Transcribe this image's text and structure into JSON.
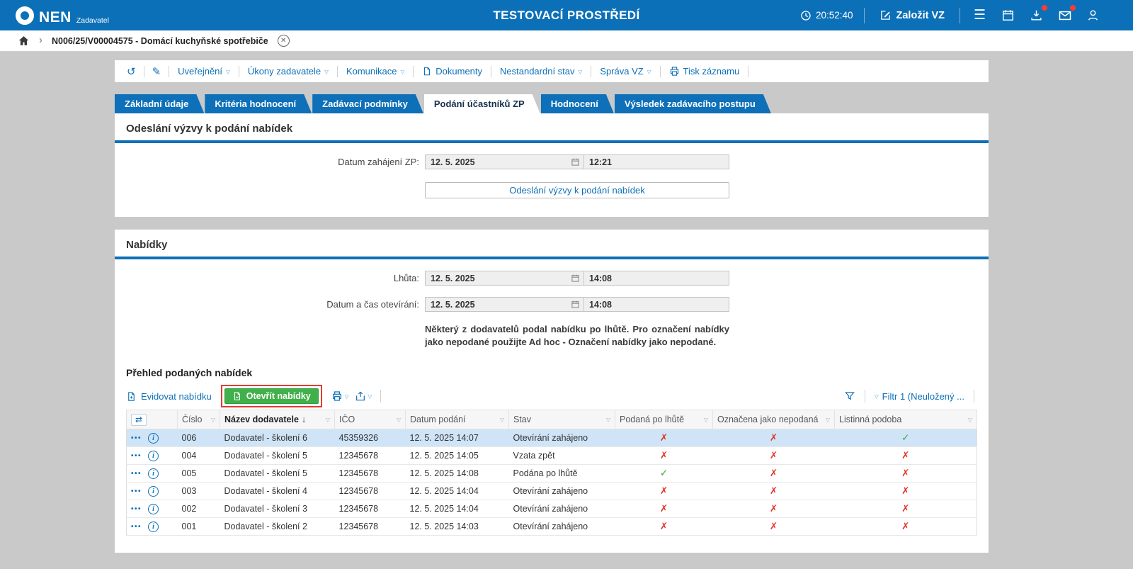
{
  "topbar": {
    "brand": "NEN",
    "brand_sub": "Zadavatel",
    "env_title": "TESTOVACÍ PROSTŘEDÍ",
    "clock": "20:52:40",
    "create_button": "Založit VZ"
  },
  "breadcrumb": {
    "record": "N006/25/V00004575 - Domácí kuchyňské spotřebiče"
  },
  "record_toolbar": {
    "uverejneni": "Uveřejnění",
    "ukony": "Úkony zadavatele",
    "komunikace": "Komunikace",
    "dokumenty": "Dokumenty",
    "nestandardni": "Nestandardní stav",
    "sprava": "Správa VZ",
    "tisk": "Tisk záznamu"
  },
  "tabs": [
    {
      "label": "Základní údaje",
      "active": "false"
    },
    {
      "label": "Kritéria hodnocení",
      "active": "false"
    },
    {
      "label": "Zadávací podmínky",
      "active": "false"
    },
    {
      "label": "Podání účastníků ZP",
      "active": "true"
    },
    {
      "label": "Hodnocení",
      "active": "false"
    },
    {
      "label": "Výsledek zadávacího postupu",
      "active": "false"
    }
  ],
  "invitation_section": {
    "title": "Odeslání výzvy k podání nabídek",
    "start_label": "Datum zahájení ZP:",
    "start_date": "12. 5. 2025",
    "start_time": "12:21",
    "send_button": "Odeslání výzvy k podání nabídek"
  },
  "offers_section": {
    "title": "Nabídky",
    "deadline_label": "Lhůta:",
    "deadline_date": "12. 5. 2025",
    "deadline_time": "14:08",
    "opening_label": "Datum a čas otevírání:",
    "opening_date": "12. 5. 2025",
    "opening_time": "14:08",
    "late_warning": "Některý z dodavatelů podal nabídku po lhůtě. Pro označení nabídky jako nepodané použijte Ad hoc - Označení nabídky jako nepodané."
  },
  "offers_grid": {
    "title": "Přehled podaných nabídek",
    "record_action": "Evidovat nabídku",
    "open_action": "Otevřít nabídky",
    "filter_label": "Filtr 1 (Neuložený ...",
    "columns": [
      "Číslo",
      "Název dodavatele",
      "IČO",
      "Datum podání",
      "Stav",
      "Podaná po lhůtě",
      "Označena jako nepodaná",
      "Listinná podoba"
    ],
    "sorted_column": "Název dodavatele",
    "sort_direction": "desc",
    "rows": [
      {
        "number": "006",
        "supplier": "Dodavatel - školení 6",
        "ico": "45359326",
        "submitted": "12. 5. 2025 14:07",
        "status": "Otevírání zahájeno",
        "late": "no",
        "marked_not_submitted": "no",
        "paper_form": "yes",
        "selected": "true"
      },
      {
        "number": "004",
        "supplier": "Dodavatel - školení 5",
        "ico": "12345678",
        "submitted": "12. 5. 2025 14:05",
        "status": "Vzata zpět",
        "late": "no",
        "marked_not_submitted": "no",
        "paper_form": "no",
        "selected": "false"
      },
      {
        "number": "005",
        "supplier": "Dodavatel - školení 5",
        "ico": "12345678",
        "submitted": "12. 5. 2025 14:08",
        "status": "Podána po lhůtě",
        "late": "yes",
        "marked_not_submitted": "no",
        "paper_form": "no",
        "selected": "false"
      },
      {
        "number": "003",
        "supplier": "Dodavatel - školení 4",
        "ico": "12345678",
        "submitted": "12. 5. 2025 14:04",
        "status": "Otevírání zahájeno",
        "late": "no",
        "marked_not_submitted": "no",
        "paper_form": "no",
        "selected": "false"
      },
      {
        "number": "002",
        "supplier": "Dodavatel - školení 3",
        "ico": "12345678",
        "submitted": "12. 5. 2025 14:04",
        "status": "Otevírání zahájeno",
        "late": "no",
        "marked_not_submitted": "no",
        "paper_form": "no",
        "selected": "false"
      },
      {
        "number": "001",
        "supplier": "Dodavatel - školení 2",
        "ico": "12345678",
        "submitted": "12. 5. 2025 14:03",
        "status": "Otevírání zahájeno",
        "late": "no",
        "marked_not_submitted": "no",
        "paper_form": "no",
        "selected": "false"
      }
    ]
  },
  "icons": {
    "menu": "☰",
    "dropdown_caret": "▽",
    "undo": "↺",
    "pencil": "✎",
    "row_menu": "•••",
    "info": "i",
    "sort_desc": "↓",
    "column_chooser": "⇄",
    "close": "✕",
    "chevron": "›",
    "check": "✓",
    "cross": "✗"
  },
  "colors": {
    "primary_blue": "#0d70b8",
    "green_action": "#41b04a",
    "red_flag": "#e2342b",
    "green_flag": "#3aaa35",
    "selected_row": "#cfe4f7",
    "highlight_red": "#e03c31"
  }
}
